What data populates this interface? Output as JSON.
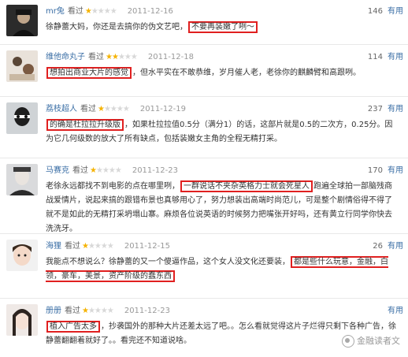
{
  "reviews": [
    {
      "user": "mr兔",
      "action": "看过",
      "stars_filled": "★",
      "stars_empty": "★★★★",
      "date": "2011-12-16",
      "useful_count": "146",
      "useful_label": "有用",
      "text_before": "徐静蕾大妈，你还是去搞你的伪文艺吧，",
      "highlight": "不要再装嫩了咧～",
      "text_after": ""
    },
    {
      "user": "维他命丸子",
      "action": "看过",
      "stars_filled": "★★",
      "stars_empty": "★★★",
      "date": "2011-12-18",
      "useful_count": "114",
      "useful_label": "有用",
      "text_before": "",
      "highlight": "想拍出商业大片的感觉",
      "text_after": "，但水平实在不敢恭维，岁月催人老，老徐你的麒麟臂和高跟咧。"
    },
    {
      "user": "荔枝超人",
      "action": "看过",
      "stars_filled": "★",
      "stars_empty": "★★★★",
      "date": "2011-12-19",
      "useful_count": "237",
      "useful_label": "有用",
      "text_before": "",
      "highlight": "的确是杜拉拉升级版",
      "text_after": "，如果杜拉拉值0.5分（满分1）的话，这部片就是0.5的二次方，0.25分。因为它几何级数的放大了所有缺点，包括装嫩女主角的全程无精打采。"
    },
    {
      "user": "马赛克",
      "action": "看过",
      "stars_filled": "★",
      "stars_empty": "★★★★",
      "date": "2011-12-23",
      "useful_count": "170",
      "useful_label": "有用",
      "text_before": "老徐永远都找不到电影的点在哪里咧，",
      "highlight": "一群说话不夹杂英格力士就会死星人",
      "text_after": "跑遍全球拍一部脑残商战爱情片，说起来搞的跟错布景也真够用心了，努力想装出高端时尚范儿，可是整个剧情俗得不得了就不是如此的无精打采坍塌山寨。麻烦各位说英语的时候努力把嘴张开好吗，还有黄立行同学你快去洗洗牙。"
    },
    {
      "user": "海狸",
      "action": "看过",
      "stars_filled": "★",
      "stars_empty": "★★★★",
      "date": "2011-12-15",
      "useful_count": "26",
      "useful_label": "有用",
      "text_before": "我能点不想说么？徐静蕾的又一个傻逼作品，这个女人没文化还要装，",
      "highlight": "都是些什么玩意，金融，白领，豪车，美景，资产阶级的蠢东西",
      "text_after": ""
    },
    {
      "user": "册册",
      "action": "看过",
      "stars_filled": "★",
      "stars_empty": "★★★★",
      "date": "2011-12-23",
      "useful_count": "",
      "useful_label": "有用",
      "text_before": "",
      "highlight": "植入广告太多",
      "text_after": "，抄袭国外的那种大片还差太远了吧。。怎么看就觉得这片子烂得只剩下各种广告，徐静蕾翻翻着就好了。。看完还不知道说啥。"
    }
  ],
  "watermark": "金融读者文"
}
